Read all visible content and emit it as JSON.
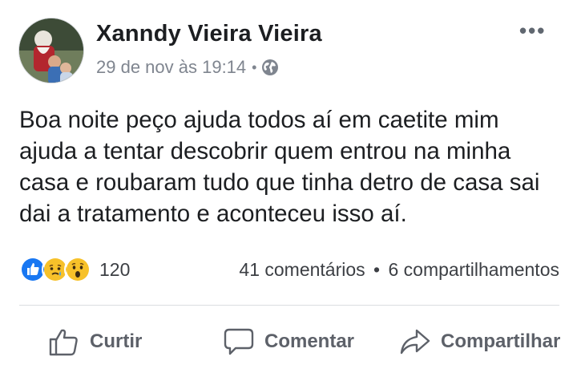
{
  "post": {
    "author": "Xanndy Vieira Vieira",
    "timestamp": "29 de nov às 19:14",
    "meta_separator": "•",
    "privacy_icon": "globe-icon",
    "more_label": "•••",
    "text": "Boa noite peço ajuda todos aí em caetite mim ajuda a tentar descobrir quem entrou na minha casa e roubaram tudo que tinha detro de casa sai dai a tratamento e aconteceu isso aí."
  },
  "reactions": {
    "icons": [
      "like-reaction-icon",
      "sad-reaction-icon",
      "wow-reaction-icon"
    ],
    "count": "120"
  },
  "stats": {
    "comments": "41 comentários",
    "separator": "•",
    "shares": "6 compartilhamentos"
  },
  "actions": {
    "like_label": "Curtir",
    "comment_label": "Comentar",
    "share_label": "Compartilhar"
  },
  "colors": {
    "like_blue": "#1877f2",
    "reaction_yellow": "#f7c12a",
    "muted_text": "#7f858f",
    "action_gray": "#5d6169"
  }
}
